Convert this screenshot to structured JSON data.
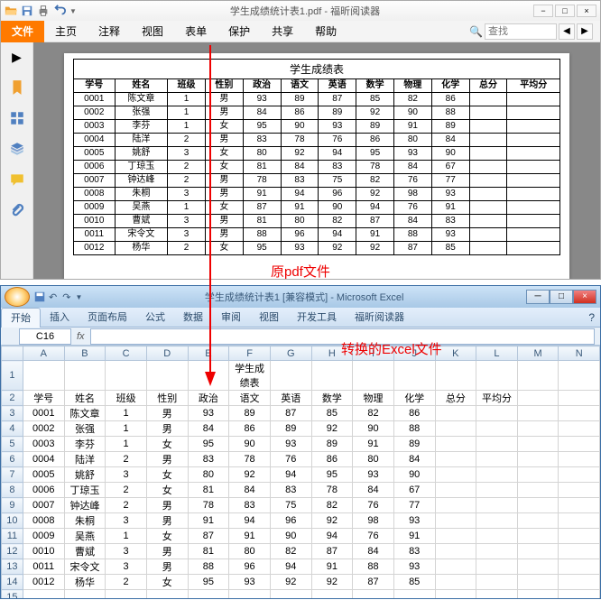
{
  "pdf": {
    "title": "学生成绩统计表1.pdf - 福昕阅读器",
    "tabs": [
      "文件",
      "主页",
      "注释",
      "视图",
      "表单",
      "保护",
      "共享",
      "帮助"
    ],
    "search_placeholder": "查找"
  },
  "excel": {
    "title": "学生成绩统计表1 [兼容模式] - Microsoft Excel",
    "tabs": [
      "开始",
      "插入",
      "页面布局",
      "公式",
      "数据",
      "审阅",
      "视图",
      "开发工具",
      "福昕阅读器"
    ],
    "namebox": "C16",
    "cols": [
      "A",
      "B",
      "C",
      "D",
      "E",
      "F",
      "G",
      "H",
      "I",
      "J",
      "K",
      "L",
      "M",
      "N"
    ]
  },
  "annotations": {
    "src": "原pdf文件",
    "dst": "转换的Excel文件"
  },
  "table": {
    "caption": "学生成绩表",
    "headers": [
      "学号",
      "姓名",
      "班级",
      "性别",
      "政治",
      "语文",
      "英语",
      "数学",
      "物理",
      "化学",
      "总分",
      "平均分"
    ],
    "rows": [
      [
        "0001",
        "陈文章",
        "1",
        "男",
        "93",
        "89",
        "87",
        "85",
        "82",
        "86",
        "",
        ""
      ],
      [
        "0002",
        "张强",
        "1",
        "男",
        "84",
        "86",
        "89",
        "92",
        "90",
        "88",
        "",
        ""
      ],
      [
        "0003",
        "李芬",
        "1",
        "女",
        "95",
        "90",
        "93",
        "89",
        "91",
        "89",
        "",
        ""
      ],
      [
        "0004",
        "陆洋",
        "2",
        "男",
        "83",
        "78",
        "76",
        "86",
        "80",
        "84",
        "",
        ""
      ],
      [
        "0005",
        "姚舒",
        "3",
        "女",
        "80",
        "92",
        "94",
        "95",
        "93",
        "90",
        "",
        ""
      ],
      [
        "0006",
        "丁琼玉",
        "2",
        "女",
        "81",
        "84",
        "83",
        "78",
        "84",
        "67",
        "",
        ""
      ],
      [
        "0007",
        "钟达峰",
        "2",
        "男",
        "78",
        "83",
        "75",
        "82",
        "76",
        "77",
        "",
        ""
      ],
      [
        "0008",
        "朱桐",
        "3",
        "男",
        "91",
        "94",
        "96",
        "92",
        "98",
        "93",
        "",
        ""
      ],
      [
        "0009",
        "吴燕",
        "1",
        "女",
        "87",
        "91",
        "90",
        "94",
        "76",
        "91",
        "",
        ""
      ],
      [
        "0010",
        "曹斌",
        "3",
        "男",
        "81",
        "80",
        "82",
        "87",
        "84",
        "83",
        "",
        ""
      ],
      [
        "0011",
        "宋令文",
        "3",
        "男",
        "88",
        "96",
        "94",
        "91",
        "88",
        "93",
        "",
        ""
      ],
      [
        "0012",
        "杨华",
        "2",
        "女",
        "95",
        "93",
        "92",
        "92",
        "87",
        "85",
        "",
        ""
      ]
    ]
  }
}
